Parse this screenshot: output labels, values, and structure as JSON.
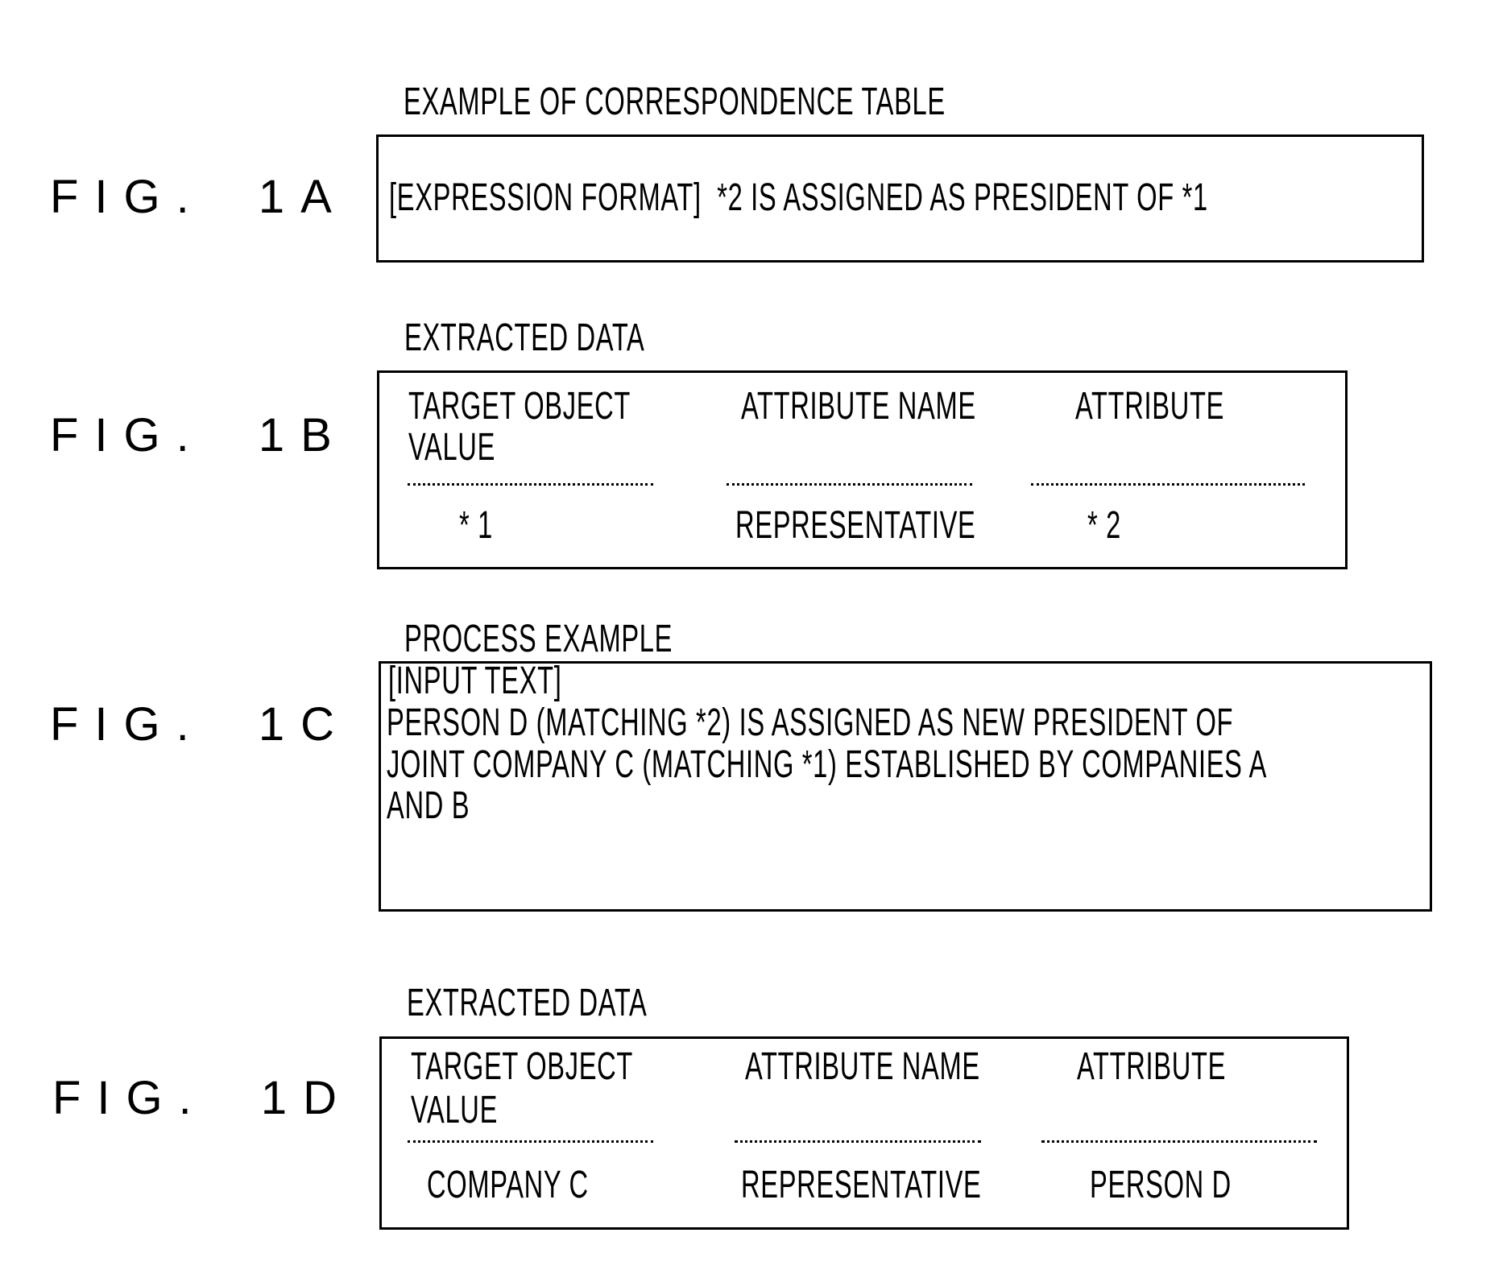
{
  "figures": {
    "fig1a": {
      "label": "FIG. 1A",
      "caption": "EXAMPLE OF CORRESPONDENCE TABLE",
      "text": "[EXPRESSION FORMAT]  *2 IS ASSIGNED AS PRESIDENT OF *1"
    },
    "fig1b": {
      "label": "FIG. 1B",
      "caption": "EXTRACTED DATA",
      "columns": [
        {
          "header_line1": "TARGET OBJECT",
          "header_line2": "VALUE",
          "value": "* 1"
        },
        {
          "header_line1": "ATTRIBUTE NAME",
          "header_line2": "",
          "value": "REPRESENTATIVE"
        },
        {
          "header_line1": "ATTRIBUTE",
          "header_line2": "",
          "value": "* 2"
        }
      ]
    },
    "fig1c": {
      "label": "FIG. 1C",
      "caption": "PROCESS EXAMPLE",
      "lines": [
        "[INPUT TEXT]",
        "PERSON D (MATCHING *2) IS ASSIGNED AS NEW PRESIDENT OF",
        "JOINT COMPANY C (MATCHING *1) ESTABLISHED BY COMPANIES A",
        "AND B"
      ]
    },
    "fig1d": {
      "label": "FIG. 1D",
      "caption": "EXTRACTED DATA",
      "columns": [
        {
          "header_line1": "TARGET OBJECT",
          "header_line2": "VALUE",
          "value": "COMPANY C"
        },
        {
          "header_line1": "ATTRIBUTE NAME",
          "header_line2": "",
          "value": "REPRESENTATIVE"
        },
        {
          "header_line1": "ATTRIBUTE",
          "header_line2": "",
          "value": "PERSON D"
        }
      ]
    }
  }
}
